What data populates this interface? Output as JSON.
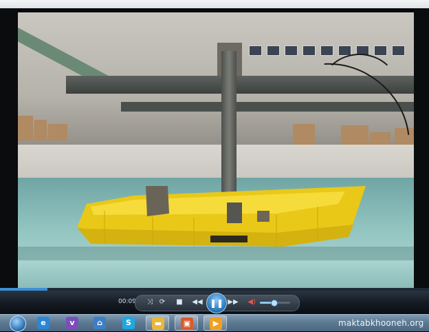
{
  "player": {
    "time_elapsed": "00:09",
    "progress_fraction": 0.11,
    "volume_fraction": 0.45,
    "controls": {
      "shuffle_icon": "shuffle-icon",
      "repeat_icon": "repeat-icon",
      "stop_icon": "stop-icon",
      "previous_icon": "rewind-icon",
      "play_pause_icon": "pause-icon",
      "next_icon": "fast-forward-icon",
      "mute_icon": "speaker-icon"
    },
    "accent_color": "#3b8fd6"
  },
  "video": {
    "scene": "boat-in-wave-tank",
    "boat_color": "#f1d01c"
  },
  "taskbar": {
    "apps": [
      {
        "name": "internet-explorer-icon",
        "color": "#2a86d6",
        "glyph": "e"
      },
      {
        "name": "viber-icon",
        "color": "#7b4fb8",
        "glyph": "v"
      },
      {
        "name": "app-icon",
        "color": "#3d7fc4",
        "glyph": "⌂"
      },
      {
        "name": "skype-icon",
        "color": "#1ca9e6",
        "glyph": "S"
      },
      {
        "name": "folder-icon",
        "color": "#e9b73b",
        "glyph": "▬"
      },
      {
        "name": "media-app-icon",
        "color": "#d95a2b",
        "glyph": "▣"
      },
      {
        "name": "media-player-icon",
        "color": "#f0a020",
        "glyph": "▶"
      }
    ],
    "watermark": "maktabkhooneh.org"
  }
}
